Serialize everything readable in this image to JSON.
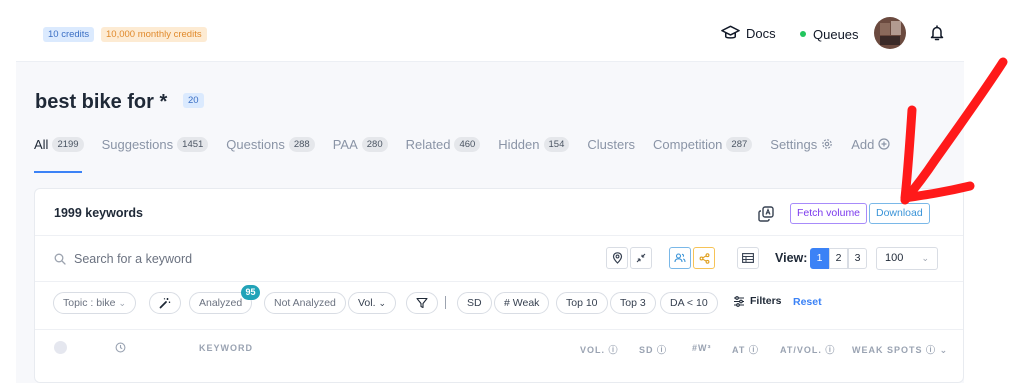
{
  "credits": {
    "credits": "10 credits",
    "monthly": "10,000 monthly credits"
  },
  "nav": {
    "docs": "Docs",
    "queues": "Queues"
  },
  "page": {
    "title": "best bike for *",
    "title_count": "20"
  },
  "tabs": [
    {
      "label": "All",
      "count": "2199"
    },
    {
      "label": "Suggestions",
      "count": "1451"
    },
    {
      "label": "Questions",
      "count": "288"
    },
    {
      "label": "PAA",
      "count": "280"
    },
    {
      "label": "Related",
      "count": "460"
    },
    {
      "label": "Hidden",
      "count": "154"
    },
    {
      "label": "Clusters",
      "count": ""
    },
    {
      "label": "Competition",
      "count": "287"
    },
    {
      "label": "Settings",
      "count": ""
    },
    {
      "label": "Add",
      "count": ""
    }
  ],
  "card": {
    "keyword_count": "1999 keywords",
    "fetch_volume": "Fetch volume",
    "download": "Download"
  },
  "search": {
    "placeholder": "Search for a keyword"
  },
  "view": {
    "label": "View:",
    "pages": [
      "1",
      "2",
      "3"
    ],
    "active_page": "1",
    "per_page": "100"
  },
  "filters": {
    "topic": "Topic : bike",
    "analyzed": "Analyzed",
    "analyzed_badge": "95",
    "not_analyzed": "Not Analyzed",
    "vol": "Vol.",
    "sd": "SD",
    "weak": "# Weak",
    "top10": "Top 10",
    "top3": "Top 3",
    "da": "DA < 10",
    "filters_label": "Filters",
    "reset": "Reset"
  },
  "table": {
    "headers": {
      "keyword": "KEYWORD",
      "vol": "VOL.",
      "sd": "SD",
      "w3": "#W³",
      "at": "AT",
      "at_vol": "AT/VOL.",
      "weak_spots": "WEAK SPOTS"
    }
  },
  "colors": {
    "accent": "#3b82f6",
    "queue_dot": "#22c55e",
    "fetch": "#7c3aed",
    "download": "#3a94d8",
    "badge": "#22a3b8"
  }
}
